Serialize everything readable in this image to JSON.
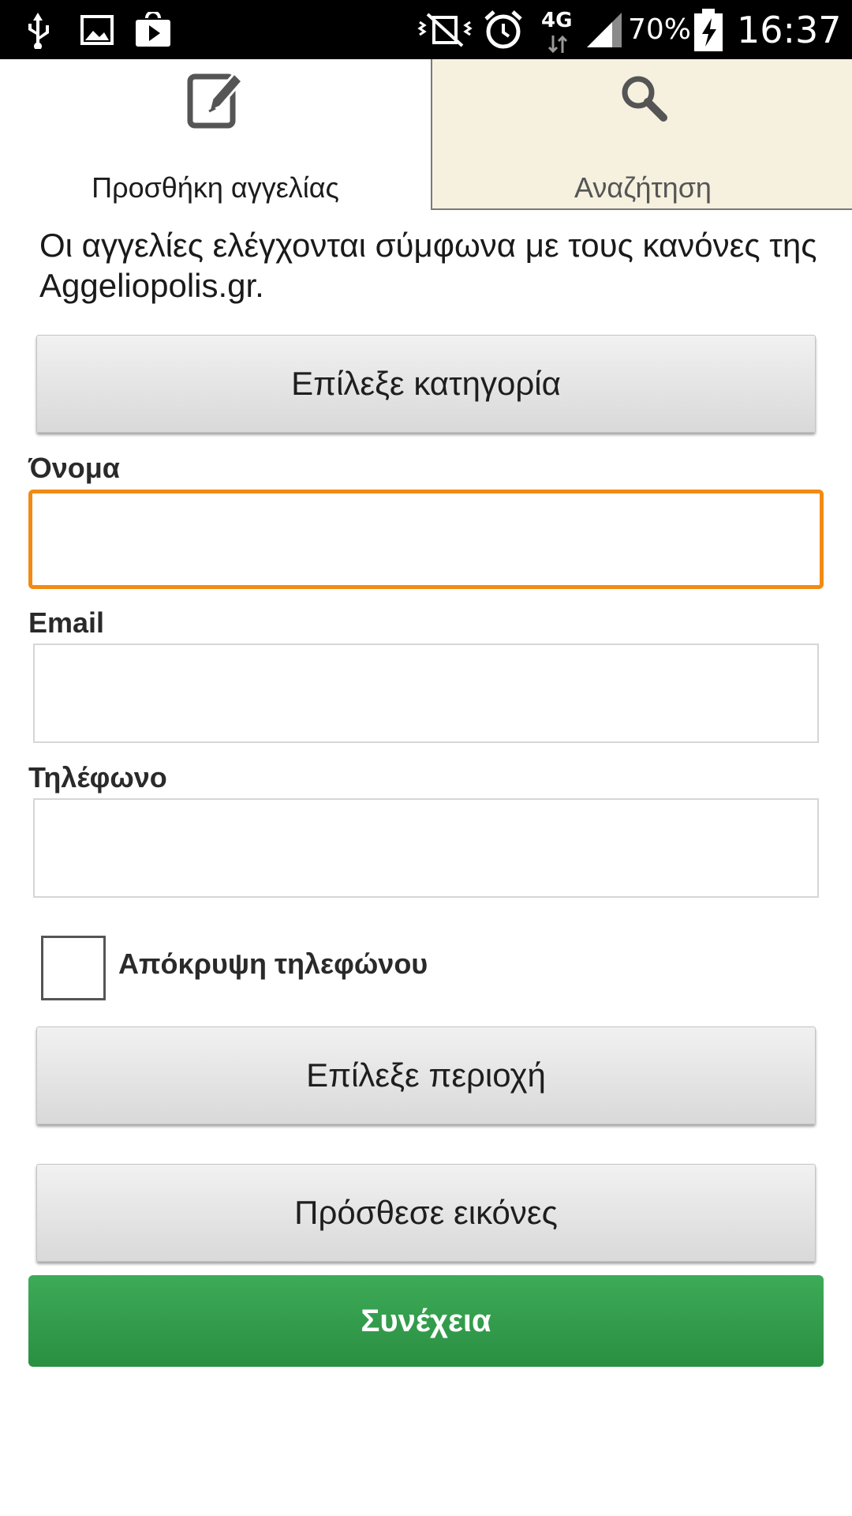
{
  "status_bar": {
    "battery_percent": "70%",
    "time": "16:37",
    "network": "4G",
    "icons": [
      "usb-icon",
      "image-icon",
      "play-store-icon",
      "vibrate-icon",
      "alarm-icon",
      "network-4g-icon",
      "signal-icon",
      "battery-charging-icon"
    ]
  },
  "tabs": [
    {
      "label": "Προσθήκη αγγελίας",
      "icon": "edit-icon",
      "selected": true
    },
    {
      "label": "Αναζήτηση",
      "icon": "search-icon",
      "selected": false
    }
  ],
  "intro_text": "Οι αγγελίες ελέγχονται σύμφωνα με τους κανόνες της Aggeliopolis.gr.",
  "form": {
    "category_button": "Επίλεξε κατηγορία",
    "name_label": "Όνομα",
    "name_value": "",
    "email_label": "Email",
    "email_value": "",
    "phone_label": "Τηλέφωνο",
    "phone_value": "",
    "hide_phone_label": "Απόκρυψη τηλεφώνου",
    "hide_phone_checked": false,
    "region_button": "Επίλεξε περιοχή",
    "images_button": "Πρόσθεσε εικόνες",
    "continue_button": "Συνέχεια"
  },
  "colors": {
    "focus_border": "#f28a13",
    "continue_bg": "#34a04d",
    "inactive_tab_bg": "#f6f0df"
  }
}
